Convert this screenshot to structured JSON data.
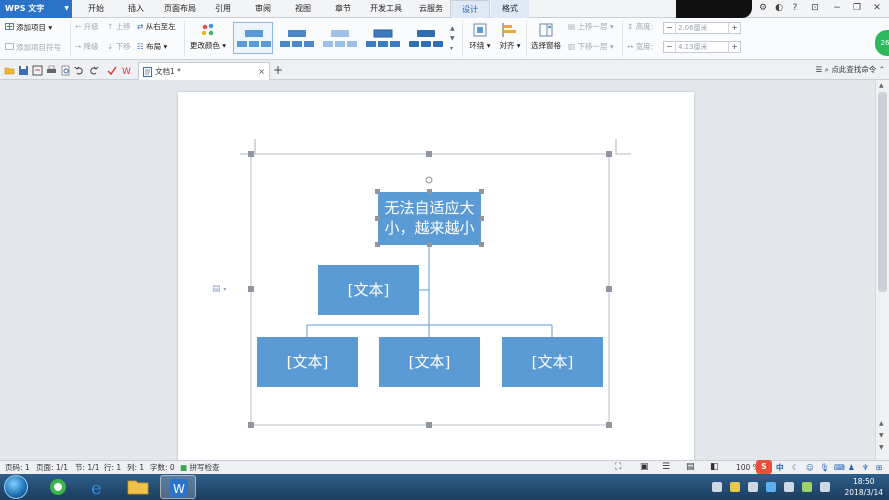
{
  "app": {
    "name": "WPS 文字",
    "tabs": [
      "开始",
      "插入",
      "页面布局",
      "引用",
      "审阅",
      "视图",
      "章节",
      "开发工具",
      "云服务",
      "设计",
      "格式"
    ],
    "active_tab": "设计"
  },
  "ribbon": {
    "add_item": "添加项目",
    "add_bullet": "添加项目符号",
    "promote": "升级",
    "demote": "降级",
    "move_up": "上移",
    "move_down": "下移",
    "right_to_left": "从右至左",
    "layout": "布局",
    "change_color": "更改颜色",
    "wrap": "环绕",
    "align": "对齐",
    "selection_pane": "选择窗格",
    "bring_forward": "上移一层",
    "send_backward": "下移一层",
    "height_label": "高度:",
    "height_value": "2.06厘米",
    "width_label": "宽度:",
    "width_value": "4.13厘米",
    "minus": "−",
    "plus": "+"
  },
  "document": {
    "tab_title": "文档1 *",
    "close": "×",
    "add": "+",
    "search_hint": "点此查找命令"
  },
  "smartart": {
    "top_line1": "无法自适应大",
    "top_line2": "小，越来越小",
    "assistant": "[文本]",
    "child1": "[文本]",
    "child2": "[文本]",
    "child3": "[文本]",
    "box_color": "#5b9bd5"
  },
  "status": {
    "page_no": "页码: 1",
    "pages": "页面: 1/1",
    "section": "节: 1/1",
    "line": "行: 1",
    "column": "列: 1",
    "words": "字数: 0",
    "spell": "拼写检查",
    "zoom": "100 %",
    "ime_cn": "中"
  },
  "taskbar": {
    "time": "18:50",
    "date": "2018/3/14"
  }
}
